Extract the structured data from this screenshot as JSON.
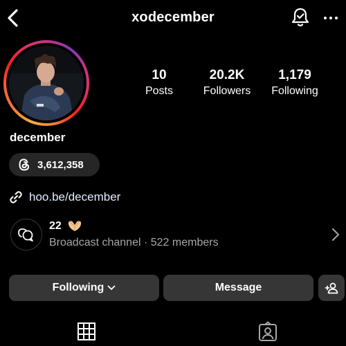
{
  "header": {
    "username": "xodecember",
    "icons": {
      "back": "chevron-left-icon",
      "notifications": "bell-check-icon",
      "more": "more-horizontal-icon"
    }
  },
  "profile": {
    "display_name": "december",
    "stats": [
      {
        "value": "10",
        "label": "Posts"
      },
      {
        "value": "20.2K",
        "label": "Followers"
      },
      {
        "value": "1,179",
        "label": "Following"
      }
    ],
    "threads_followers": "3,612,358",
    "link": "hoo.be/december"
  },
  "channel": {
    "name": "22",
    "emoji": "heart-hands",
    "subtitle": "Broadcast channel · 522 members"
  },
  "actions": {
    "following_label": "Following",
    "message_label": "Message",
    "add_user_icon": "add-user-icon"
  },
  "tabs": [
    {
      "icon": "grid-icon",
      "selected": true
    },
    {
      "icon": "tagged-icon",
      "selected": false
    }
  ],
  "colors": {
    "background": "#000000",
    "button": "#363636",
    "pill": "#262626",
    "secondary_text": "#a8a8a8",
    "link": "#e0f1ff"
  }
}
